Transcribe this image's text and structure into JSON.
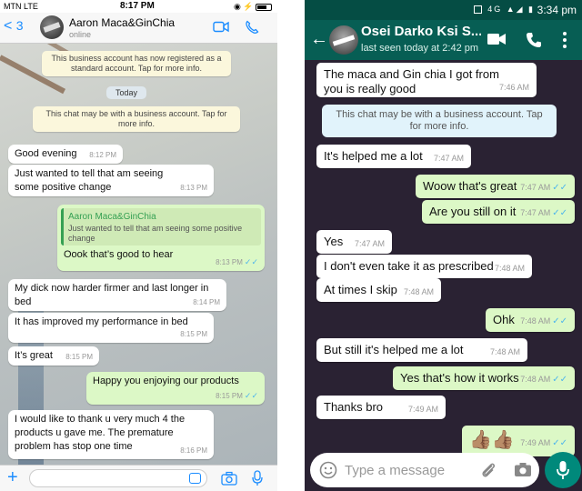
{
  "left": {
    "status": {
      "carrier": "MTN  LTE",
      "time": "8:17 PM",
      "battery_label": ""
    },
    "header": {
      "back_label": "<",
      "back_count": "3",
      "contact_name": "Aaron Maca&GinChia",
      "presence": "online"
    },
    "notes": [
      "This business account has now registered as a standard account. Tap for more info.",
      "This chat may be with a business account. Tap for more info."
    ],
    "date_chip": "Today",
    "messages": [
      {
        "text": "Good evening",
        "time": "8:12 PM"
      },
      {
        "text": "Just wanted to tell that am seeing some positive change",
        "time": "8:13 PM"
      },
      {
        "quote_name": "Aaron Maca&GinChia",
        "quote_text": "Just wanted to tell that am seeing some positive change",
        "text": "Oook that’s good to hear",
        "time": "8:13 PM"
      },
      {
        "text": "My dick now harder firmer and last longer in bed",
        "time": "8:14 PM"
      },
      {
        "text": "It has improved my performance in bed",
        "time": "8:15 PM"
      },
      {
        "text": "It’s great",
        "time": "8:15 PM"
      },
      {
        "text": "Happy you enjoying our products",
        "time": "8:15 PM"
      },
      {
        "text": "I would like to thank u very much 4 the products u gave me. The premature problem has stop one time",
        "time": "8:16 PM"
      }
    ]
  },
  "right": {
    "status": {
      "time": "3:34 pm",
      "signal": "4G"
    },
    "header": {
      "contact_name": "Osei Darko Ksi S...",
      "last_seen": "last seen today at 2:42 pm"
    },
    "note": "This chat may be with a business account. Tap for more info.",
    "messages": [
      {
        "text": "The maca and Gin chia I got from you is really good",
        "time": "7:46 AM"
      },
      {
        "text": "It's helped me a lot",
        "time": "7:47 AM"
      },
      {
        "text": "Woow that's great",
        "time": "7:47 AM"
      },
      {
        "text": "Are you still on it",
        "time": "7:47 AM"
      },
      {
        "text": "Yes",
        "time": "7:47 AM"
      },
      {
        "text": "I don't even take it as prescribed",
        "time": "7:48 AM"
      },
      {
        "text": "At times I skip",
        "time": "7:48 AM"
      },
      {
        "text": "Ohk",
        "time": "7:48 AM"
      },
      {
        "text": "But still it's helped me a lot",
        "time": "7:48 AM"
      },
      {
        "text": "Yes that's how it works",
        "time": "7:48 AM"
      },
      {
        "text": "Thanks bro",
        "time": "7:49 AM"
      },
      {
        "text": "👍🏽👍🏽",
        "time": "7:49 AM"
      }
    ],
    "input": {
      "placeholder": "Type a message"
    }
  },
  "colors": {
    "ios_blue": "#1a8cff",
    "wa_green_dark": "#075e54",
    "wa_teal": "#00897b",
    "outgoing_bubble": "#dcf8c6",
    "read_tick": "#4fb6ec"
  }
}
